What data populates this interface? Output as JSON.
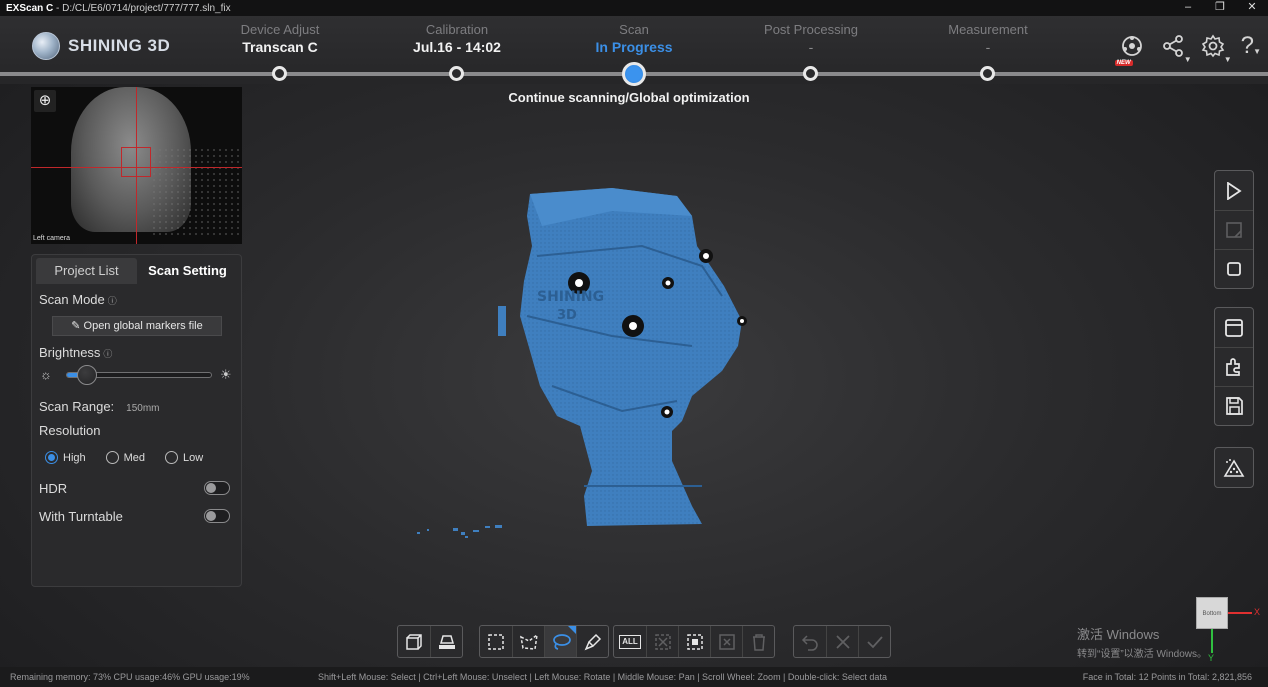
{
  "titlebar": {
    "app": "EXScan C",
    "separator": "-",
    "path": "D:/CL/E6/0714/project/777/777.sln_fix",
    "controls": [
      "‒",
      "❐",
      "✕"
    ]
  },
  "brand": "SHINING 3D",
  "steps": [
    {
      "label": "Device Adjust",
      "value": "Transcan C",
      "state": "done"
    },
    {
      "label": "Calibration",
      "value": "Jul.16 - 14:02",
      "state": "done"
    },
    {
      "label": "Scan",
      "value": "In Progress",
      "state": "active"
    },
    {
      "label": "Post Processing",
      "value": "-",
      "state": "pending"
    },
    {
      "label": "Measurement",
      "value": "-",
      "state": "pending"
    }
  ],
  "header_icons": {
    "new_badge": "NEW"
  },
  "hint": "Continue scanning/Global optimization",
  "camera": {
    "caption": "Left camera"
  },
  "panel": {
    "tabs": [
      "Project List",
      "Scan Setting"
    ],
    "active_tab": "Scan Setting",
    "scan_mode_label": "Scan Mode",
    "open_markers_label": "Open global markers file",
    "brightness_label": "Brightness",
    "brightness_value_fraction": 0.1,
    "scan_range_label": "Scan Range:",
    "scan_range_value": "150mm",
    "resolution_label": "Resolution",
    "resolution_options": [
      "High",
      "Med",
      "Low"
    ],
    "resolution_selected": "High",
    "hdr_label": "HDR",
    "hdr_on": false,
    "turntable_label": "With Turntable",
    "turntable_on": false
  },
  "model_text": [
    "SHINING",
    "3D"
  ],
  "viewcube": {
    "face": "Bottom",
    "x_label": "X",
    "y_label": "Y"
  },
  "watermark": {
    "line1": "激活 Windows",
    "line2": "转到“设置”以激活 Windows。"
  },
  "status": {
    "left": "Remaining memory: 73%  CPU usage:46%   GPU usage:19%",
    "center": "Shift+Left Mouse: Select | Ctrl+Left Mouse: Unselect | Left Mouse: Rotate | Middle Mouse: Pan | Scroll Wheel: Zoom | Double-click: Select data",
    "right": "Face in Total: 12   Points in Total: 2,821,856"
  },
  "bottom_all_label": "ALL",
  "colors": {
    "accent": "#3b8fe6",
    "scan_model": "#3f7fbf",
    "marker_red": "#c0282b"
  }
}
